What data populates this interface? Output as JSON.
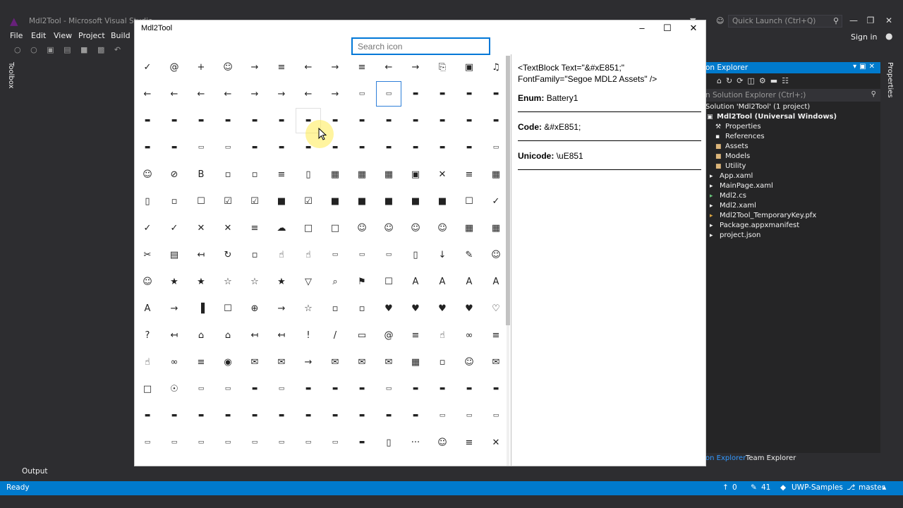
{
  "vs": {
    "title": "Mdl2Tool - Microsoft Visual Studio",
    "quick_launch_placeholder": "Quick Launch (Ctrl+Q)",
    "menu": [
      "File",
      "Edit",
      "View",
      "Project",
      "Build"
    ],
    "sign_in": "Sign in",
    "toolbox_label": "Toolbox",
    "properties_label": "Properties",
    "output_label": "Output",
    "status": {
      "ready": "Ready",
      "up_count": "0",
      "edit_count": "41",
      "repo": "UWP-Samples",
      "branch": "master"
    },
    "solution_explorer": {
      "title": "on Explorer",
      "search_placeholder": "n Solution Explorer (Ctrl+;)",
      "nodes": [
        {
          "label": "Solution 'Mdl2Tool' (1 project)",
          "icon": "solution-icon"
        },
        {
          "label": "Mdl2Tool (Universal Windows)",
          "icon": "project-icon"
        },
        {
          "label": "Properties",
          "icon": "wrench-icon"
        },
        {
          "label": "References",
          "icon": "references-icon"
        },
        {
          "label": "Assets",
          "icon": "folder-icon"
        },
        {
          "label": "Models",
          "icon": "folder-icon"
        },
        {
          "label": "Utility",
          "icon": "folder-icon"
        },
        {
          "label": "App.xaml",
          "icon": "xaml-file-icon"
        },
        {
          "label": "MainPage.xaml",
          "icon": "xaml-file-icon"
        },
        {
          "label": "Mdl2.cs",
          "icon": "csharp-file-icon"
        },
        {
          "label": "Mdl2.xaml",
          "icon": "xaml-file-icon"
        },
        {
          "label": "Mdl2Tool_TemporaryKey.pfx",
          "icon": "key-file-icon"
        },
        {
          "label": "Package.appxmanifest",
          "icon": "manifest-file-icon"
        },
        {
          "label": "project.json",
          "icon": "json-file-icon"
        }
      ],
      "tabs": [
        "on Explorer",
        "Team Explorer"
      ]
    }
  },
  "app": {
    "title": "Mdl2Tool",
    "search_placeholder": "Search icon",
    "selected_icon": {
      "xaml_line1": "<TextBlock Text=\"&#xE851;\"",
      "xaml_line2": "FontFamily=\"Segoe MDL2 Assets\" />",
      "enum_label": "Enum:",
      "enum_value": "Battery1",
      "code_label": "Code:",
      "code_value": "&#xE851;",
      "unicode_label": "Unicode:",
      "unicode_value": "\\uE851"
    },
    "icon_grid": {
      "columns": 14,
      "selected_row": 1,
      "selected_col": 9,
      "hover_row": 2,
      "hover_col": 6,
      "scroll_fraction": 0.0,
      "rows": [
        [
          "check-mark-icon",
          "at-icon",
          "add-icon",
          "add-friend-icon",
          "forward-icon",
          "align-center-icon",
          "align-left-icon",
          "align-right-icon",
          "bullets-icon",
          "back-icon",
          "forward-arrow-icon",
          "attach-icon",
          "camera-audio-icon",
          "audio-icon"
        ],
        [
          "back-to-window-icon",
          "back-to-window-small-icon",
          "arrow-left-icon",
          "arrow-left-2-icon",
          "arrow-right-icon",
          "arrow-right-2-icon",
          "arrow-left-3-icon",
          "arrow-right-3-icon",
          "battery0-icon",
          "battery1-icon",
          "battery2-icon",
          "battery3-icon",
          "battery4-icon",
          "battery5-icon"
        ],
        [
          "battery6-icon",
          "battery7-icon",
          "battery8-icon",
          "battery9-icon",
          "battery10-icon",
          "battery-charging0-icon",
          "battery-charging1-icon",
          "battery-charging2-icon",
          "battery-charging3-icon",
          "battery-charging4-icon",
          "battery-charging5-icon",
          "battery-charging6-icon",
          "battery-charging7-icon",
          "battery-charging8-icon"
        ],
        [
          "battery-charging9-icon",
          "battery-charging10-icon",
          "battery-saver0-icon",
          "battery-saver1-icon",
          "battery-saver2-icon",
          "battery-saver3-icon",
          "battery-saver4-icon",
          "battery-saver5-icon",
          "battery-saver6-icon",
          "battery-saver7-icon",
          "battery-saver8-icon",
          "battery-saver9-icon",
          "battery-saver10-icon",
          "battery-unknown-icon"
        ],
        [
          "block-contact-icon",
          "blocked-icon",
          "bold-icon",
          "bookmarks-icon",
          "browse-photos-icon",
          "bullets-list-icon",
          "calculator-icon",
          "calendar-icon",
          "calendar-day-icon",
          "calendar-reply-icon",
          "camera-icon",
          "cancel-icon",
          "caption-icon",
          "cc-icon"
        ],
        [
          "cell-phone-icon",
          "character-icon",
          "checkbox-icon",
          "checkbox-checked-icon",
          "checkbox-composite-icon",
          "checkbox-fill-icon",
          "checkbox-composite-fill-icon",
          "stop-icon",
          "square-fill-icon",
          "square-fill-2-icon",
          "small-square-icon",
          "small-square-2-icon",
          "square-outline-icon",
          "check-small-icon"
        ],
        [
          "checkmark-icon",
          "accept-icon",
          "clear-icon",
          "clear-selection-icon",
          "closed-caption-icon",
          "cloud-icon",
          "comment-icon",
          "message-icon",
          "contact-icon",
          "contact-info-icon",
          "contact-list-icon",
          "contact-presence-icon",
          "copy-icon",
          "crop-icon"
        ],
        [
          "cut-icon",
          "delete-icon",
          "directions-icon",
          "refresh-sync-icon",
          "disconnect-drive-icon",
          "dislike-icon",
          "like-dislike-icon",
          "dock-bottom-icon",
          "dock-left-icon",
          "dock-right-icon",
          "document-icon",
          "download-icon",
          "edit-icon",
          "emoji-icon"
        ],
        [
          "emoji2-icon",
          "favorite-icon",
          "favorite-star-fill-icon",
          "favorite-list-icon",
          "outline-star-icon",
          "solid-star-icon",
          "filter-icon",
          "find-icon",
          "flag-icon",
          "full-screen-icon",
          "font-icon",
          "font-color-icon",
          "font-decrease-icon",
          "font-increase-icon"
        ],
        [
          "font-size-icon",
          "forward-2-icon",
          "network-icon",
          "full-screen-2-icon",
          "globe-icon",
          "go-icon",
          "go-to-start-icon",
          "go-to-today-icon",
          "hang-up-icon",
          "heart-broken-icon",
          "heart-broken-fill-icon",
          "heart-fill-icon",
          "heart-fill-2-icon",
          "heart-icon"
        ],
        [
          "help-icon",
          "dash-icon",
          "house-icon",
          "home-icon",
          "import-icon",
          "import-all-icon",
          "important-icon",
          "italic-icon",
          "keyboard-icon",
          "leave-chat-icon",
          "library-icon",
          "like-icon",
          "link-icon",
          "list-icon"
        ],
        [
          "like-2-icon",
          "link-2-icon",
          "list-2-icon",
          "location-icon",
          "mail-icon",
          "mail-fill-icon",
          "mail-forward-icon",
          "mail-fill-2-icon",
          "mail-reply-icon",
          "mail-reply-all-icon",
          "manage-icon",
          "map-pin-icon",
          "people-icon",
          "voicemail-icon"
        ],
        [
          "message-2-icon",
          "microphone-icon",
          "battery-empty-icon",
          "battery-low-icon",
          "battery-full-icon",
          "battery-quarter-icon",
          "battery-half-icon",
          "battery-third-icon",
          "battery-two-thirds-icon",
          "battery-three-quarters-icon",
          "battery-full-2-icon",
          "battery-full-3-icon",
          "battery-full-4-icon",
          "battery-charging-icon"
        ],
        [
          "battery-charge-0-icon",
          "battery-charge-1-icon",
          "battery-charge-2-icon",
          "battery-charge-3-icon",
          "battery-charge-4-icon",
          "battery-charge-5-icon",
          "battery-charge-6-icon",
          "battery-charge-7-icon",
          "battery-charge-8-icon",
          "battery-charge-9-icon",
          "battery-charge-10-icon",
          "battery-saver-a-icon",
          "battery-saver-b-icon",
          "battery-saver-c-icon"
        ],
        [
          "battery-saver-d-icon",
          "battery-saver-e-icon",
          "battery-saver-f-icon",
          "battery-saver-g-icon",
          "battery-saver-h-icon",
          "battery-saver-i-icon",
          "battery-saver-j-icon",
          "battery-saver-k-icon",
          "battery-unknown-2-icon",
          "phone-icon",
          "more-icon",
          "mobile-contact-icon",
          "list-alt-icon",
          "mute-icon",
          "page-icon"
        ]
      ]
    }
  }
}
